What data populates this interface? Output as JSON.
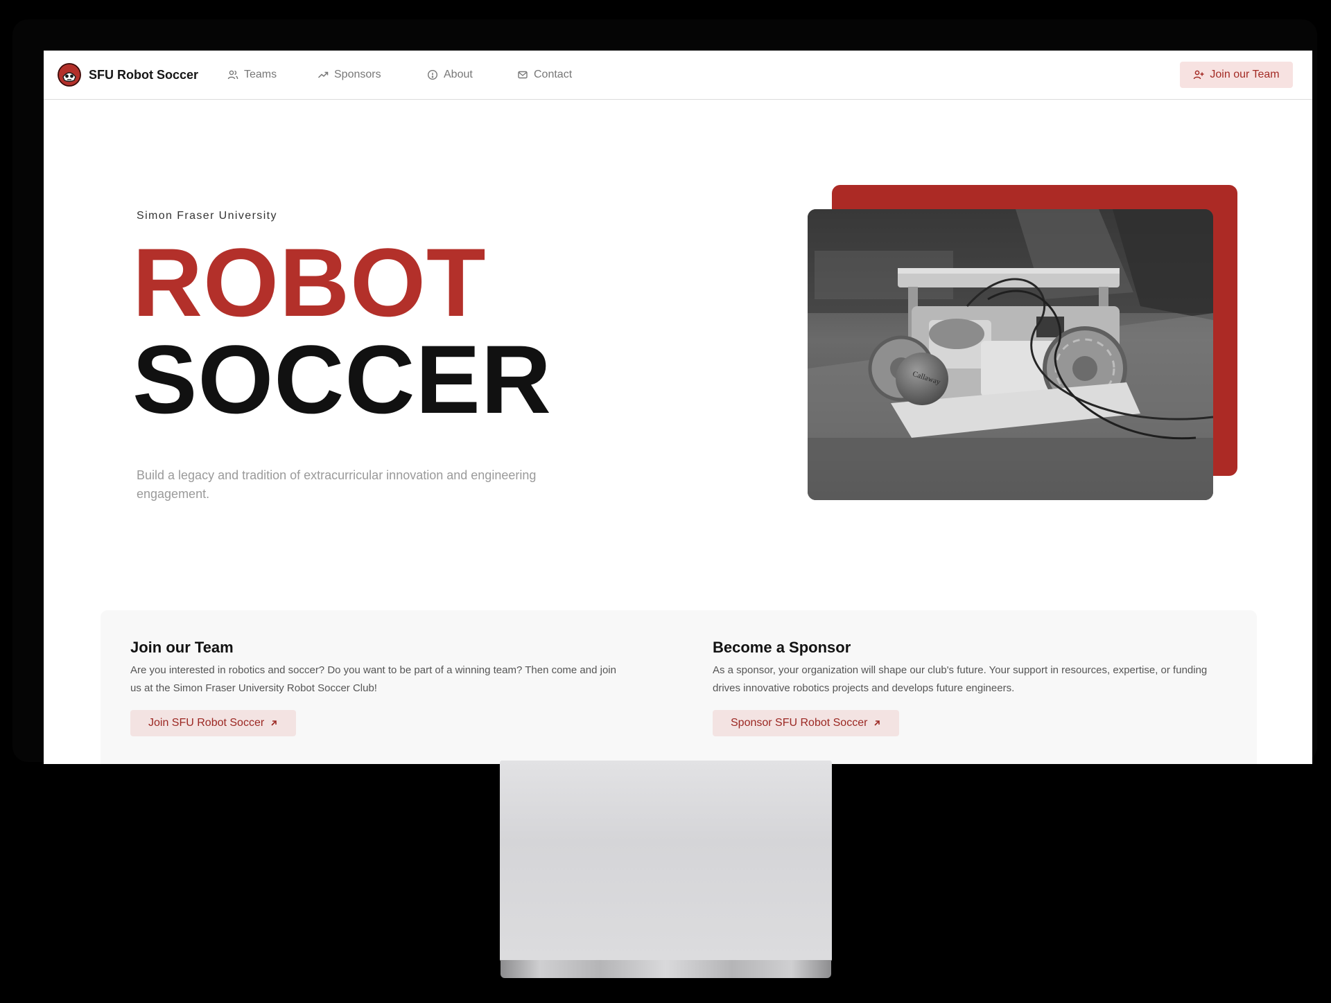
{
  "nav": {
    "brand_name": "SFU Robot Soccer",
    "links": [
      {
        "label": "Teams",
        "icon": "users-icon"
      },
      {
        "label": "Sponsors",
        "icon": "trending-up-icon"
      },
      {
        "label": "About",
        "icon": "info-icon"
      },
      {
        "label": "Contact",
        "icon": "mail-icon"
      }
    ],
    "cta_label": "Join our Team",
    "cta_icon": "user-plus-icon"
  },
  "hero": {
    "eyebrow": "Simon Fraser University",
    "title_line1": "ROBOT",
    "title_line2": "SOCCER",
    "subtitle": "Build a legacy and tradition of extracurricular innovation and engineering engagement.",
    "image_subject": "robot-soccer-robot-photo",
    "ball_text": "Callaway"
  },
  "cards": {
    "join": {
      "heading": "Join our Team",
      "body": "Are you interested in robotics and soccer? Do you want to be part of a winning team? Then come and join us at the Simon Fraser University Robot Soccer Club!",
      "button_label": "Join SFU Robot Soccer"
    },
    "sponsor": {
      "heading": "Become a Sponsor",
      "body": "As a sponsor, your organization will shape our club's future. Your support in resources, expertise, or funding drives innovative robotics projects and develops future engineers.",
      "button_label": "Sponsor SFU Robot Soccer"
    }
  },
  "colors": {
    "accent": "#b3302a",
    "accent_soft": "#f7e2e1",
    "text_dark": "#111111",
    "text_muted": "#9a9a9a",
    "section_bg": "#f8f8f8"
  }
}
